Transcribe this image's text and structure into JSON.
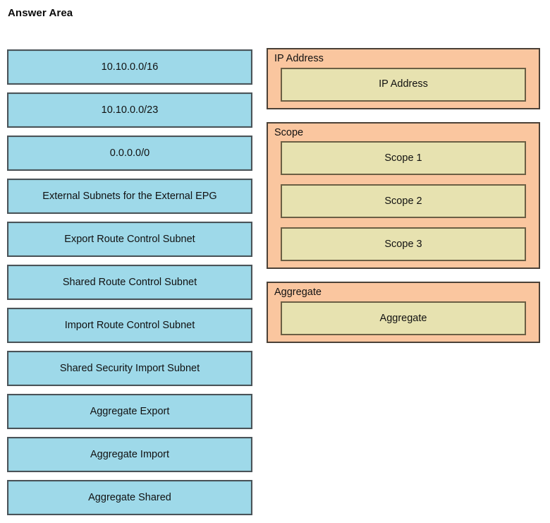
{
  "page": {
    "title": "Answer Area",
    "background_color": "#ffffff"
  },
  "colors": {
    "source_tile_fill": "#9ed9e9",
    "source_tile_border": "#4a5358",
    "group_fill": "#fac69f",
    "group_border": "#4b4137",
    "slot_fill": "#e7e2b0",
    "slot_border": "#6b5f44",
    "text": "#111111"
  },
  "source_list": {
    "name": "answer-options",
    "items": [
      {
        "label": "10.10.0.0/16"
      },
      {
        "label": "10.10.0.0/23"
      },
      {
        "label": "0.0.0.0/0"
      },
      {
        "label": "External Subnets for the External EPG"
      },
      {
        "label": "Export Route Control Subnet"
      },
      {
        "label": "Shared Route Control Subnet"
      },
      {
        "label": "Import Route Control Subnet"
      },
      {
        "label": "Shared Security Import Subnet"
      },
      {
        "label": "Aggregate Export"
      },
      {
        "label": "Aggregate Import"
      },
      {
        "label": "Aggregate Shared"
      }
    ]
  },
  "target_groups": [
    {
      "label": "IP Address",
      "slots": [
        {
          "label": "IP Address"
        }
      ]
    },
    {
      "label": "Scope",
      "slots": [
        {
          "label": "Scope 1"
        },
        {
          "label": "Scope 2"
        },
        {
          "label": "Scope 3"
        }
      ]
    },
    {
      "label": "Aggregate",
      "slots": [
        {
          "label": "Aggregate"
        }
      ]
    }
  ]
}
